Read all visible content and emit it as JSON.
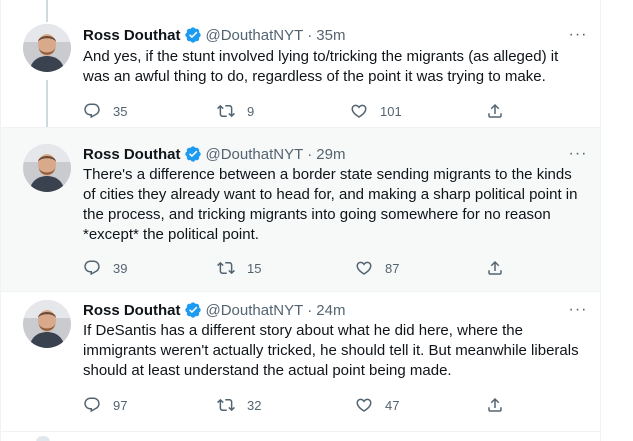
{
  "tweets": [
    {
      "name": "Ross Douthat",
      "handle": "@DouthatNYT",
      "dot": "·",
      "time": "35m",
      "text": "And yes, if the stunt involved lying to/tricking the migrants (as alleged) it\nwas an awful thing to do, regardless of the point it was trying to make.",
      "replies": "35",
      "retweets": "9",
      "likes": "101",
      "more": "···"
    },
    {
      "name": "Ross Douthat",
      "handle": "@DouthatNYT",
      "dot": "·",
      "time": "29m",
      "text": "There's a difference between a border state sending migrants to the kinds\nof cities they already want to head for, and making a sharp political point in\nthe process, and tricking migrants into going somewhere for no reason\n*except* the political point.",
      "replies": "39",
      "retweets": "15",
      "likes": "87",
      "more": "···"
    },
    {
      "name": "Ross Douthat",
      "handle": "@DouthatNYT",
      "dot": "·",
      "time": "24m",
      "text": "If DeSantis has a different story about what he did here, where the\nimmigrants weren't actually tricked, he should tell it. But meanwhile liberals\nshould at least understand the actual point being made.",
      "replies": "97",
      "retweets": "32",
      "likes": "47",
      "more": "···"
    }
  ],
  "colors": {
    "verified": "#1d9bf0",
    "secondary_text": "#536471",
    "highlight_bg": "#f7f9f9",
    "thread_line": "#cfd9de"
  },
  "icons": {
    "reply": "reply-icon",
    "retweet": "retweet-icon",
    "like": "like-icon",
    "share": "share-icon",
    "verified": "verified-badge-icon",
    "more": "more-options-icon"
  }
}
